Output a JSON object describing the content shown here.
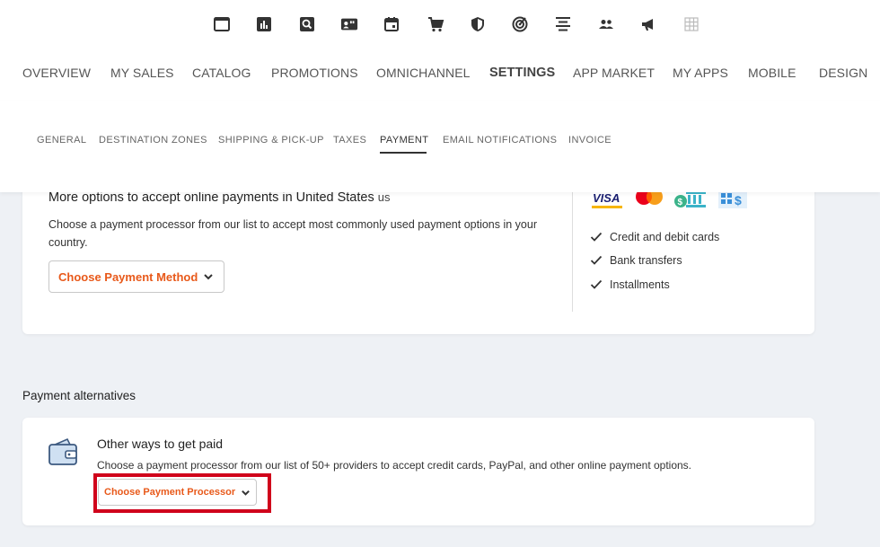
{
  "main_nav": {
    "items": [
      "OVERVIEW",
      "MY SALES",
      "CATALOG",
      "PROMOTIONS",
      "OMNICHANNEL",
      "SETTINGS",
      "APP MARKET",
      "MY APPS",
      "MOBILE",
      "DESIGN"
    ],
    "active": "SETTINGS"
  },
  "sub_nav": {
    "items": [
      "GENERAL",
      "DESTINATION ZONES",
      "SHIPPING & PICK-UP",
      "TAXES",
      "PAYMENT",
      "EMAIL NOTIFICATIONS",
      "INVOICE"
    ],
    "active": "PAYMENT"
  },
  "online_payments": {
    "title": "More options to accept online payments in United States",
    "country_code": "us",
    "description": "Choose a payment processor from our list to accept most commonly used payment options in your country.",
    "button_label": "Choose Payment Method",
    "logos": [
      "VISA"
    ],
    "features": [
      "Credit and debit cards",
      "Bank transfers",
      "Installments"
    ]
  },
  "alternatives": {
    "section_label": "Payment alternatives",
    "title": "Other ways to get paid",
    "description": "Choose a payment processor from our list of 50+ providers to accept credit cards, PayPal, and other online payment options.",
    "button_label": "Choose Payment Processor"
  },
  "colors": {
    "accent_orange": "#e8591a",
    "highlight_red": "#d0021b",
    "background": "#eef1f5"
  }
}
